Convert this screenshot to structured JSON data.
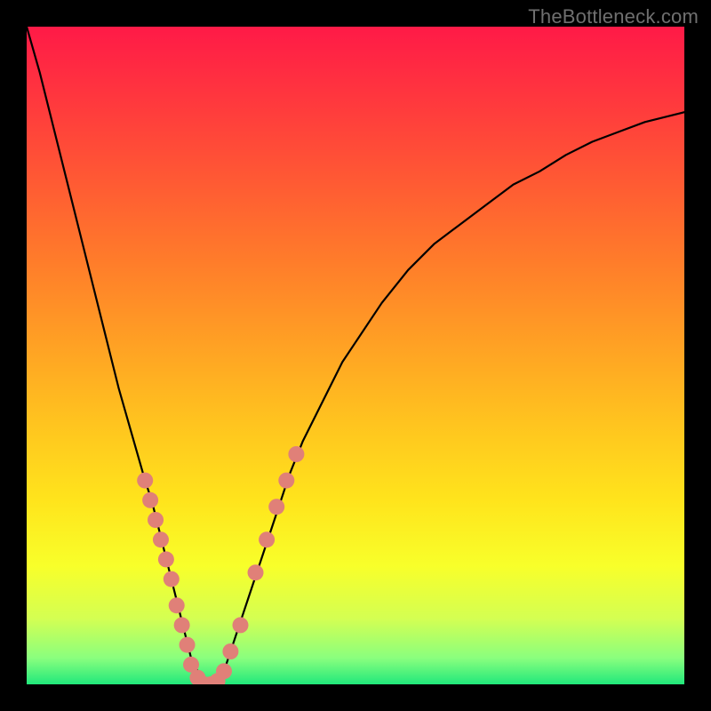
{
  "watermark": "TheBottleneck.com",
  "chart_data": {
    "type": "line",
    "title": "",
    "xlabel": "",
    "ylabel": "",
    "xlim": [
      0,
      100
    ],
    "ylim": [
      0,
      100
    ],
    "grid": false,
    "legend": false,
    "series": [
      {
        "name": "curve",
        "color": "#000000",
        "x": [
          0,
          2,
          4,
          6,
          8,
          10,
          12,
          14,
          16,
          18,
          19,
          20,
          21,
          22,
          23,
          24,
          25,
          26,
          27,
          28,
          29,
          30,
          32,
          34,
          36,
          38,
          40,
          42,
          44,
          46,
          48,
          50,
          54,
          58,
          62,
          66,
          70,
          74,
          78,
          82,
          86,
          90,
          94,
          98,
          100
        ],
        "y": [
          100,
          93,
          85,
          77,
          69,
          61,
          53,
          45,
          38,
          31,
          28,
          24,
          20,
          16,
          12,
          8,
          4,
          2,
          0,
          0,
          0,
          2,
          8,
          14,
          20,
          26,
          32,
          37,
          41,
          45,
          49,
          52,
          58,
          63,
          67,
          70,
          73,
          76,
          78,
          80.5,
          82.5,
          84,
          85.5,
          86.5,
          87
        ]
      }
    ],
    "markers": {
      "name": "highlight-points",
      "color": "#e08078",
      "radius": 9,
      "points": [
        {
          "x": 18.0,
          "y": 31
        },
        {
          "x": 18.8,
          "y": 28
        },
        {
          "x": 19.6,
          "y": 25
        },
        {
          "x": 20.4,
          "y": 22
        },
        {
          "x": 21.2,
          "y": 19
        },
        {
          "x": 22.0,
          "y": 16
        },
        {
          "x": 22.8,
          "y": 12
        },
        {
          "x": 23.6,
          "y": 9
        },
        {
          "x": 24.4,
          "y": 6
        },
        {
          "x": 25.0,
          "y": 3
        },
        {
          "x": 26.0,
          "y": 1
        },
        {
          "x": 27.0,
          "y": 0
        },
        {
          "x": 28.0,
          "y": 0
        },
        {
          "x": 29.0,
          "y": 0.5
        },
        {
          "x": 30.0,
          "y": 2
        },
        {
          "x": 31.0,
          "y": 5
        },
        {
          "x": 32.5,
          "y": 9
        },
        {
          "x": 34.8,
          "y": 17
        },
        {
          "x": 36.5,
          "y": 22
        },
        {
          "x": 38.0,
          "y": 27
        },
        {
          "x": 39.5,
          "y": 31
        },
        {
          "x": 41.0,
          "y": 35
        }
      ]
    }
  }
}
